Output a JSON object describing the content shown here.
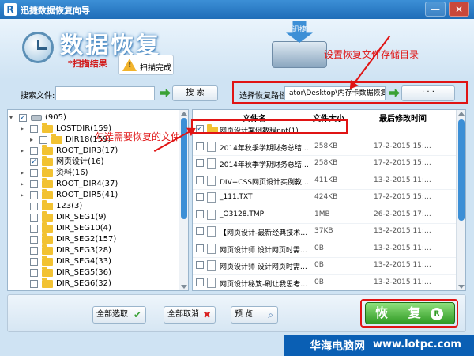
{
  "window": {
    "app_icon": "R",
    "title": "迅捷数据恢复向导",
    "minimize": "—",
    "close": "✕"
  },
  "header": {
    "heading": "数据恢复",
    "scan_result": "*扫描结果",
    "scan_status": "扫描完成",
    "drive_arrow_text": "迅捷"
  },
  "annotations": {
    "set_path": "设置恢复文件存储目录",
    "tick_files": "勾选需要恢复的文件"
  },
  "search": {
    "label": "搜索文件:",
    "value": "",
    "button": "搜 索"
  },
  "path": {
    "label": "选择恢复路径",
    "value": ":ator\\Desktop\\内存卡数据恢复",
    "browse_button": "· · ·"
  },
  "tree": [
    {
      "label": "(905)",
      "type": "drive",
      "checked": true,
      "expander": "▾"
    },
    {
      "label": "LOSTDIR(159)",
      "type": "folder",
      "checked": false,
      "expander": "▸"
    },
    {
      "label": "DIR18(159)",
      "type": "folder",
      "checked": false,
      "expander": "▸"
    },
    {
      "label": "ROOT_DIR3(17)",
      "type": "folder",
      "checked": false,
      "expander": "▸"
    },
    {
      "label": "网页设计(16)",
      "type": "folder",
      "checked": true,
      "expander": ""
    },
    {
      "label": "资料(16)",
      "type": "folder",
      "checked": false,
      "expander": "▸"
    },
    {
      "label": "ROOT_DIR4(37)",
      "type": "folder",
      "checked": false,
      "expander": "▸"
    },
    {
      "label": "ROOT_DIR5(41)",
      "type": "folder",
      "checked": false,
      "expander": "▸"
    },
    {
      "label": "123(3)",
      "type": "folder",
      "checked": false,
      "expander": ""
    },
    {
      "label": "DIR_SEG1(9)",
      "type": "folder",
      "checked": false,
      "expander": ""
    },
    {
      "label": "DIR_SEG10(4)",
      "type": "folder",
      "checked": false,
      "expander": ""
    },
    {
      "label": "DIR_SEG2(157)",
      "type": "folder",
      "checked": false,
      "expander": ""
    },
    {
      "label": "DIR_SEG3(28)",
      "type": "folder",
      "checked": false,
      "expander": ""
    },
    {
      "label": "DIR_SEG4(33)",
      "type": "folder",
      "checked": false,
      "expander": ""
    },
    {
      "label": "DIR_SEG5(36)",
      "type": "folder",
      "checked": false,
      "expander": ""
    },
    {
      "label": "DIR_SEG6(32)",
      "type": "folder",
      "checked": false,
      "expander": ""
    }
  ],
  "files": {
    "columns": {
      "name": "文件名",
      "size": "文件大小",
      "date": "最后修改时间"
    },
    "rows": [
      {
        "name": "网页设计案例教程ppt(1)",
        "size": "",
        "date": "",
        "type": "folder",
        "checked": true
      },
      {
        "name": "2014年秋季学期财务总结…",
        "size": "258KB",
        "date": "17-2-2015 15:…",
        "type": "file",
        "checked": false
      },
      {
        "name": "2014年秋季学期财务总结…",
        "size": "258KB",
        "date": "17-2-2015 15:…",
        "type": "file",
        "checked": false
      },
      {
        "name": "DIV+CSS网页设计实例教…",
        "size": "411KB",
        "date": "13-2-2015 11:…",
        "type": "file",
        "checked": false
      },
      {
        "name": "_111.TXT",
        "size": "424KB",
        "date": "17-2-2015 15:…",
        "type": "file",
        "checked": false
      },
      {
        "name": "_O3128.TMP",
        "size": "1MB",
        "date": "26-2-2015 17:…",
        "type": "file",
        "checked": false
      },
      {
        "name": "【网页设计-最新经典技术…",
        "size": "37KB",
        "date": "13-2-2015 11:…",
        "type": "file",
        "checked": false
      },
      {
        "name": "网页设计师 设计网页时需…",
        "size": "0B",
        "date": "13-2-2015 11:…",
        "type": "file",
        "checked": false
      },
      {
        "name": "网页设计师 设计网页时需…",
        "size": "0B",
        "date": "13-2-2015 11:…",
        "type": "file",
        "checked": false
      },
      {
        "name": "网页设计秘笈-刷让我思考…",
        "size": "0B",
        "date": "13-2-2015 11:…",
        "type": "file",
        "checked": false
      }
    ]
  },
  "bottom": {
    "select_all": "全部选取",
    "deselect_all": "全部取消",
    "preview": "预 览",
    "restore": "恢 复",
    "restore_icon": "R"
  },
  "watermark": {
    "cn": "华海电脑网",
    "url": "www.lotpc.com"
  },
  "colors": {
    "accent": "#3c8fd6",
    "annotation": "#e01414",
    "restore": "#2f9a24",
    "watermark_bg": "#0a5fb4"
  }
}
